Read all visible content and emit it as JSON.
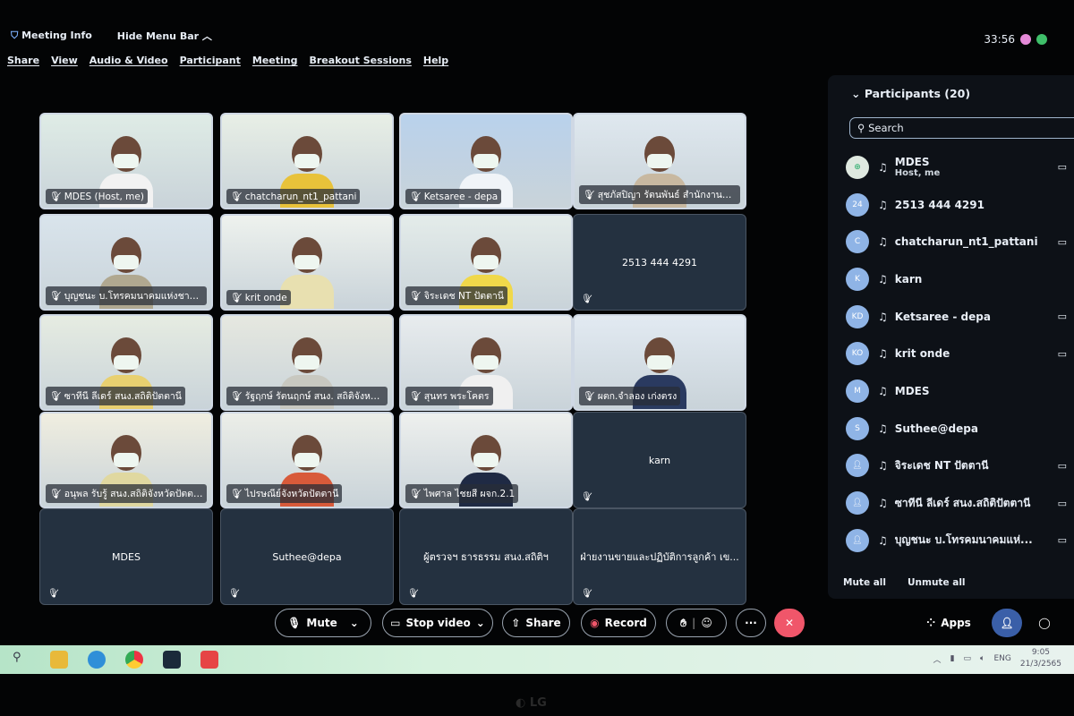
{
  "topbar": {
    "meeting_info": "Meeting Info",
    "hide_menu": "Hide Menu Bar",
    "timer": "33:56"
  },
  "menu": [
    "Share",
    "View",
    "Audio & Video",
    "Participant",
    "Meeting",
    "Breakout Sessions",
    "Help"
  ],
  "tiles": [
    {
      "name": "MDES (Host, me)",
      "video": true,
      "bg": "#dfece6",
      "shirt": "#f2f2f2"
    },
    {
      "name": "chatcharun_nt1_pattani",
      "video": true,
      "bg": "#e8efe6",
      "shirt": "#e8c23a"
    },
    {
      "name": "Ketsaree - depa",
      "video": true,
      "bg": "#b9d2ec",
      "shirt": "#f0f4f8"
    },
    {
      "name": "สุชภัสปิญา รัตนพันธ์ สำนักงานสถิ...",
      "video": true,
      "bg": "#dfe8ef",
      "shirt": "#c8b8a0"
    },
    {
      "name": "บุญชนะ บ.โทรคมนาคมแห่งชาติ ปั...",
      "video": true,
      "bg": "#d9e4ec",
      "shirt": "#b0a890"
    },
    {
      "name": "krit onde",
      "video": true,
      "bg": "#eef2ee",
      "shirt": "#e8e0b0"
    },
    {
      "name": "จิระเดช NT ปัตตานี",
      "video": true,
      "bg": "#e4ecea",
      "shirt": "#f0d84a"
    },
    {
      "name": "2513 444 4291",
      "video": false
    },
    {
      "name": "ซาทีนี ลีเดร์ สนง.สถิติปัตตานี",
      "video": true,
      "bg": "#e6ece2",
      "shirt": "#e8d070"
    },
    {
      "name": "รัฐฤกษ์ รัตนฤกษ์ สนง. สถิติจังหวัดปั...",
      "video": true,
      "bg": "#e6e8e0",
      "shirt": "#c8c8c0"
    },
    {
      "name": "สุนทร พระโคตร",
      "video": true,
      "bg": "#e8ecee",
      "shirt": "#f0f0f0"
    },
    {
      "name": "ผตก.จำลอง เก่งตรง",
      "video": true,
      "bg": "#e2eaf2",
      "shirt": "#2a3a60"
    },
    {
      "name": "อนุพล รับรู้ สนง.สถิติจังหวัดปัตตานี",
      "video": true,
      "bg": "#f0eee0",
      "shirt": "#e0d8a0"
    },
    {
      "name": "ไปรษณีย์จังหวัดปัตตานี",
      "video": true,
      "bg": "#eceee8",
      "shirt": "#d85a3a"
    },
    {
      "name": "ไพศาล ไชยสี ผจก.2.1",
      "video": true,
      "bg": "#eef0ee",
      "shirt": "#1f2a44"
    },
    {
      "name": "karn",
      "video": false
    },
    {
      "name": "MDES",
      "video": false
    },
    {
      "name": "Suthee@depa",
      "video": false
    },
    {
      "name": "ผู้ตรวจฯ ธารธรรม สนง.สถิติฯ",
      "video": false
    },
    {
      "name": "ฝ่ายงานขายและปฏิบัติการลูกค้า เข...",
      "video": false
    }
  ],
  "participants": {
    "title": "Participants (20)",
    "search_placeholder": "Search",
    "mute_all": "Mute all",
    "unmute_all": "Unmute all",
    "items": [
      {
        "initials": "",
        "name": "MDES",
        "sub": "Host, me",
        "cam": true
      },
      {
        "initials": "24",
        "name": "2513 444 4291",
        "cam": false
      },
      {
        "initials": "C",
        "name": "chatcharun_nt1_pattani",
        "cam": true
      },
      {
        "initials": "K",
        "name": "karn",
        "cam": false
      },
      {
        "initials": "KD",
        "name": "Ketsaree - depa",
        "cam": true
      },
      {
        "initials": "KO",
        "name": "krit onde",
        "cam": true
      },
      {
        "initials": "M",
        "name": "MDES",
        "cam": false
      },
      {
        "initials": "S",
        "name": "Suthee@depa",
        "cam": false
      },
      {
        "initials": "",
        "name": "จิระเดช NT ปัตตานี",
        "cam": true
      },
      {
        "initials": "",
        "name": "ซาทีนี ลีเดร์ สนง.สถิติปัตตานี",
        "cam": true
      },
      {
        "initials": "",
        "name": "บุญชนะ บ.โทรคมนาคมแห่...",
        "cam": true
      }
    ]
  },
  "controls": {
    "mute": "Mute",
    "stop_video": "Stop video",
    "share": "Share",
    "record": "Record",
    "more": "···",
    "leave": "✕",
    "apps": "Apps"
  },
  "taskbar": {
    "lang": "ENG",
    "time": "9:05",
    "date": "21/3/2565"
  },
  "monitor_brand": "LG",
  "colors": {
    "leave": "#f0566a",
    "panel": "#0d1117",
    "tile_empty": "#243140",
    "accent": "#3a5fa8"
  }
}
